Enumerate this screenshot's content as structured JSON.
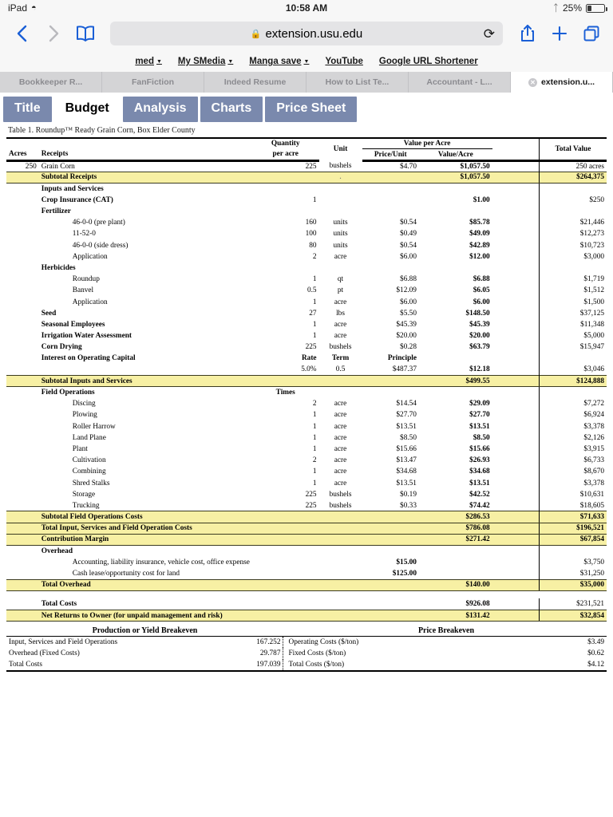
{
  "status_bar": {
    "device": "iPad",
    "wifi_icon": "wifi-icon",
    "time": "10:58 AM",
    "bluetooth_icon": "bluetooth-icon",
    "battery_percent": "25%"
  },
  "toolbar": {
    "back_icon": "back-chevron-icon",
    "forward_icon": "forward-chevron-icon",
    "bookmarks_icon": "book-icon",
    "lock_icon": "lock-icon",
    "url": "extension.usu.edu",
    "reload_icon": "reload-icon",
    "share_icon": "share-icon",
    "newtab_icon": "plus-icon",
    "tabs_icon": "tabs-icon"
  },
  "bookmarks_bar": [
    {
      "label": "med",
      "has_caret": true
    },
    {
      "label": "My SMedia",
      "has_caret": true
    },
    {
      "label": "Manga save",
      "has_caret": true
    },
    {
      "label": "YouTube",
      "has_caret": false
    },
    {
      "label": "Google URL Shortener",
      "has_caret": false
    }
  ],
  "browser_tabs": [
    {
      "title": "Bookkeeper R...",
      "active": false
    },
    {
      "title": "FanFiction",
      "active": false
    },
    {
      "title": "Indeed Resume",
      "active": false
    },
    {
      "title": "How to List Te...",
      "active": false
    },
    {
      "title": "Accountant - L...",
      "active": false
    },
    {
      "title": "extension.u...",
      "active": true,
      "close_icon": "close-icon"
    }
  ],
  "sheet_tabs": [
    {
      "label": "Title",
      "active": false
    },
    {
      "label": "Budget",
      "active": true
    },
    {
      "label": "Analysis",
      "active": false
    },
    {
      "label": "Charts",
      "active": false
    },
    {
      "label": "Price Sheet",
      "active": false
    }
  ],
  "colors": {
    "highlight_yellow": "#f7f0a4",
    "tab_blue": "#7a89ad",
    "safari_chrome": "#f7f7f7",
    "accent_blue": "#1a5fd6"
  },
  "table": {
    "caption": "Table 1. Roundup™ Ready Grain Corn, Box Elder County",
    "headers": {
      "acres": "Acres",
      "receipts": "Receipts",
      "quantity_l1": "Quantity",
      "quantity_l2": "per acre",
      "unit": "Unit",
      "value_per_acre": "Value per Acre",
      "price_unit": "Price/Unit",
      "value_acre": "Value/Acre",
      "total_value": "Total Value"
    },
    "rows": [
      {
        "kind": "data",
        "acres": "250",
        "item": "Grain Corn",
        "indent": 0,
        "qty": "225",
        "unit": "bushels",
        "price": "$4.70",
        "vpa": "$1,057.50",
        "vpa_bold": true,
        "total": "250 acres"
      },
      {
        "kind": "subtotal",
        "item": "Subtotal Receipts",
        "indent": 0,
        "qty": "",
        "unit": "",
        "price": "",
        "vpa": "$1,057.50",
        "total": "$264,375",
        "dot": true
      },
      {
        "kind": "section",
        "item": "Inputs and Services",
        "indent": 0
      },
      {
        "kind": "data",
        "item": "Crop Insurance (CAT)",
        "indent": 0,
        "item_bold": true,
        "qty": "1",
        "unit": "",
        "price": "",
        "vpa": "$1.00",
        "vpa_bold": true,
        "total": "$250"
      },
      {
        "kind": "section",
        "item": "Fertilizer",
        "indent": 0
      },
      {
        "kind": "data",
        "item": "46-0-0 (pre plant)",
        "indent": 2,
        "qty": "160",
        "unit": "units",
        "price": "$0.54",
        "vpa": "$85.78",
        "vpa_bold": true,
        "total": "$21,446"
      },
      {
        "kind": "data",
        "item": "11-52-0",
        "indent": 2,
        "qty": "100",
        "unit": "units",
        "price": "$0.49",
        "vpa": "$49.09",
        "vpa_bold": true,
        "total": "$12,273"
      },
      {
        "kind": "data",
        "item": "46-0-0 (side dress)",
        "indent": 2,
        "qty": "80",
        "unit": "units",
        "price": "$0.54",
        "vpa": "$42.89",
        "vpa_bold": true,
        "total": "$10,723"
      },
      {
        "kind": "data",
        "item": "Application",
        "indent": 2,
        "qty": "2",
        "unit": "acre",
        "price": "$6.00",
        "vpa": "$12.00",
        "vpa_bold": true,
        "total": "$3,000"
      },
      {
        "kind": "section",
        "item": "Herbicides",
        "indent": 0
      },
      {
        "kind": "data",
        "item": "Roundup",
        "indent": 2,
        "qty": "1",
        "unit": "qt",
        "price": "$6.88",
        "vpa": "$6.88",
        "vpa_bold": true,
        "total": "$1,719"
      },
      {
        "kind": "data",
        "item": "Banvel",
        "indent": 2,
        "qty": "0.5",
        "unit": "pt",
        "price": "$12.09",
        "vpa": "$6.05",
        "vpa_bold": true,
        "total": "$1,512"
      },
      {
        "kind": "data",
        "item": "Application",
        "indent": 2,
        "qty": "1",
        "unit": "acre",
        "price": "$6.00",
        "vpa": "$6.00",
        "vpa_bold": true,
        "total": "$1,500"
      },
      {
        "kind": "data",
        "item": "Seed",
        "indent": 0,
        "item_bold": true,
        "qty": "27",
        "unit": "lbs",
        "price": "$5.50",
        "vpa": "$148.50",
        "vpa_bold": true,
        "total": "$37,125"
      },
      {
        "kind": "data",
        "item": "Seasonal Employees",
        "indent": 0,
        "item_bold": true,
        "qty": "1",
        "unit": "acre",
        "price": "$45.39",
        "vpa": "$45.39",
        "vpa_bold": true,
        "total": "$11,348"
      },
      {
        "kind": "data",
        "item": "Irrigation Water Assessment",
        "indent": 0,
        "item_bold": true,
        "qty": "1",
        "unit": "acre",
        "price": "$20.00",
        "vpa": "$20.00",
        "vpa_bold": true,
        "total": "$5,000"
      },
      {
        "kind": "data",
        "item": "Corn Drying",
        "indent": 0,
        "item_bold": true,
        "qty": "225",
        "unit": "bushels",
        "price": "$0.28",
        "vpa": "$63.79",
        "vpa_bold": true,
        "total": "$15,947"
      },
      {
        "kind": "data",
        "item": "Interest on Operating Capital",
        "indent": 0,
        "item_bold": true,
        "qty": "Rate",
        "qty_bold": true,
        "unit": "Term",
        "unit_bold": true,
        "price": "Principle",
        "price_bold": true,
        "vpa": "",
        "total": ""
      },
      {
        "kind": "data",
        "item": "",
        "indent": 0,
        "qty": "5.0%",
        "unit": "0.5",
        "price": "$487.37",
        "vpa": "$12.18",
        "vpa_bold": true,
        "total": "$3,046"
      },
      {
        "kind": "subtotal",
        "item": "Subtotal Inputs and Services",
        "indent": 0,
        "qty": "",
        "unit": "",
        "price": "",
        "vpa": "$499.55",
        "total": "$124,888"
      },
      {
        "kind": "data",
        "item": "Field Operations",
        "indent": 0,
        "item_bold": true,
        "qty": "Times",
        "qty_bold": true,
        "qty_center": true,
        "unit": "",
        "price": "",
        "vpa": "",
        "total": ""
      },
      {
        "kind": "data",
        "item": "Discing",
        "indent": 2,
        "qty": "2",
        "unit": "acre",
        "price": "$14.54",
        "vpa": "$29.09",
        "vpa_bold": true,
        "total": "$7,272"
      },
      {
        "kind": "data",
        "item": "Plowing",
        "indent": 2,
        "qty": "1",
        "unit": "acre",
        "price": "$27.70",
        "vpa": "$27.70",
        "vpa_bold": true,
        "total": "$6,924"
      },
      {
        "kind": "data",
        "item": "Roller Harrow",
        "indent": 2,
        "qty": "1",
        "unit": "acre",
        "price": "$13.51",
        "vpa": "$13.51",
        "vpa_bold": true,
        "total": "$3,378"
      },
      {
        "kind": "data",
        "item": "Land Plane",
        "indent": 2,
        "qty": "1",
        "unit": "acre",
        "price": "$8.50",
        "vpa": "$8.50",
        "vpa_bold": true,
        "total": "$2,126"
      },
      {
        "kind": "data",
        "item": "Plant",
        "indent": 2,
        "qty": "1",
        "unit": "acre",
        "price": "$15.66",
        "vpa": "$15.66",
        "vpa_bold": true,
        "total": "$3,915"
      },
      {
        "kind": "data",
        "item": "Cultivation",
        "indent": 2,
        "qty": "2",
        "unit": "acre",
        "price": "$13.47",
        "vpa": "$26.93",
        "vpa_bold": true,
        "total": "$6,733"
      },
      {
        "kind": "data",
        "item": "Combining",
        "indent": 2,
        "qty": "1",
        "unit": "acre",
        "price": "$34.68",
        "vpa": "$34.68",
        "vpa_bold": true,
        "total": "$8,670"
      },
      {
        "kind": "data",
        "item": "Shred Stalks",
        "indent": 2,
        "qty": "1",
        "unit": "acre",
        "price": "$13.51",
        "vpa": "$13.51",
        "vpa_bold": true,
        "total": "$3,378"
      },
      {
        "kind": "data",
        "item": "Storage",
        "indent": 2,
        "qty": "225",
        "unit": "bushels",
        "price": "$0.19",
        "vpa": "$42.52",
        "vpa_bold": true,
        "total": "$10,631"
      },
      {
        "kind": "data",
        "item": "Trucking",
        "indent": 2,
        "qty": "225",
        "unit": "bushels",
        "price": "$0.33",
        "vpa": "$74.42",
        "vpa_bold": true,
        "total": "$18,605"
      },
      {
        "kind": "subtotal",
        "item": "Subtotal Field Operations  Costs",
        "indent": 0,
        "qty": "",
        "unit": "",
        "price": "",
        "vpa": "$286.53",
        "total": "$71,633"
      },
      {
        "kind": "subtotal",
        "item": "Total Input, Services and Field Operation Costs",
        "indent": 0,
        "qty": "",
        "unit": "",
        "price": "",
        "vpa": "$786.08",
        "total": "$196,521"
      },
      {
        "kind": "subtotal",
        "item": "Contribution Margin",
        "indent": 0,
        "qty": "",
        "unit": "",
        "price": "",
        "vpa": "$271.42",
        "total": "$67,854"
      },
      {
        "kind": "section",
        "item": "Overhead",
        "indent": 0
      },
      {
        "kind": "data",
        "item": "Accounting, liability insurance, vehicle cost, office expense",
        "indent": 2,
        "qty": "",
        "unit": "",
        "price": "$15.00",
        "price_bold": true,
        "vpa": "",
        "total": "$3,750"
      },
      {
        "kind": "data",
        "item": "Cash lease/opportunity cost for land",
        "indent": 2,
        "qty": "",
        "unit": "",
        "price": "$125.00",
        "price_bold": true,
        "vpa": "",
        "total": "$31,250"
      },
      {
        "kind": "subtotal",
        "item": "Total Overhead",
        "indent": 0,
        "qty": "",
        "unit": "",
        "price": "",
        "vpa": "$140.00",
        "total": "$35,000"
      },
      {
        "kind": "spacer"
      },
      {
        "kind": "data",
        "item": "Total Costs",
        "indent": 0,
        "item_bold": true,
        "qty": "",
        "unit": "",
        "price": "",
        "vpa": "$926.08",
        "vpa_bold": true,
        "total": "$231,521"
      },
      {
        "kind": "subtotal",
        "item": "Net Returns to Owner (for unpaid management and risk)",
        "indent": 0,
        "qty": "",
        "unit": "",
        "price": "",
        "vpa": "$131.42",
        "total": "$32,854"
      }
    ]
  },
  "breakeven": {
    "left_header": "Production or Yield Breakeven",
    "right_header": "Price Breakeven",
    "rows": [
      {
        "left_label": "Input, Services and Field Operations",
        "left_value": "167.252",
        "right_label": "Operating Costs ($/ton)",
        "right_value": "$3.49"
      },
      {
        "left_label": "Overhead (Fixed Costs)",
        "left_value": "29.787",
        "right_label": "Fixed Costs ($/ton)",
        "right_value": "$0.62"
      },
      {
        "left_label": "Total Costs",
        "left_value": "197.039",
        "right_label": "Total Costs ($/ton)",
        "right_value": "$4.12"
      }
    ]
  }
}
